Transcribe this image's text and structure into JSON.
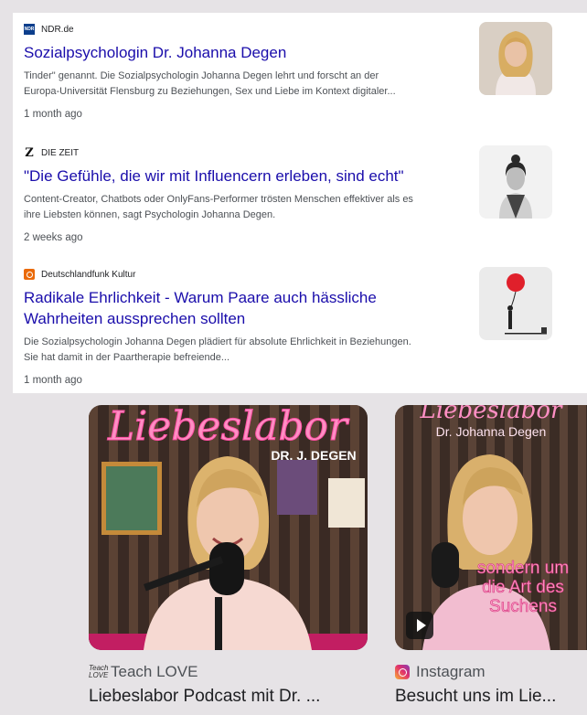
{
  "news": [
    {
      "source": "NDR.de",
      "logo_text": "NDR",
      "headline": "Sozialpsychologin Dr. Johanna Degen",
      "snippet_line1": "Tinder\" genannt. Die Sozialpsychologin Johanna Degen lehrt und forscht an der",
      "snippet_line2": "Europa-Universität Flensburg zu Beziehungen, Sex und Liebe im Kontext digitaler...",
      "age": "1 month ago"
    },
    {
      "source": "DIE ZEIT",
      "logo_text": "Z",
      "headline": "\"Die Gefühle, die wir mit Influencern erleben, sind echt\"",
      "snippet_line1": "Content-Creator, Chatbots oder OnlyFans-Performer trösten Menschen effektiver als es",
      "snippet_line2": "ihre Liebsten können, sagt Psychologin Johanna Degen.",
      "age": "2 weeks ago"
    },
    {
      "source": "Deutschlandfunk Kultur",
      "headline_line1": "Radikale Ehrlichkeit - Warum Paare auch hässliche",
      "headline_line2": "Wahrheiten aussprechen sollten",
      "snippet_line1": "Die Sozialpsychologin Johanna Degen plädiert für absolute Ehrlichkeit in Beziehungen.",
      "snippet_line2": "Sie hat damit in der Paartherapie befreiende...",
      "age": "1 month ago"
    }
  ],
  "videos": [
    {
      "neon_title": "Liebeslabor",
      "neon_subtitle": "DR. J. DEGEN",
      "source_logo": "Teach LOVE",
      "source": "Teach LOVE",
      "title": "Liebeslabor Podcast mit Dr. ..."
    },
    {
      "neon_title": "Liebeslabor",
      "neon_subtitle": "Dr. Johanna Degen",
      "caption_line1": "sondern um",
      "caption_line2": "die Art des",
      "caption_line3": "Suchens",
      "source": "Instagram",
      "title": "Besucht uns im Lie..."
    }
  ],
  "colors": {
    "link": "#1a0dab",
    "neon_pink": "#ff5fa8",
    "instagram": "#e1306c"
  }
}
